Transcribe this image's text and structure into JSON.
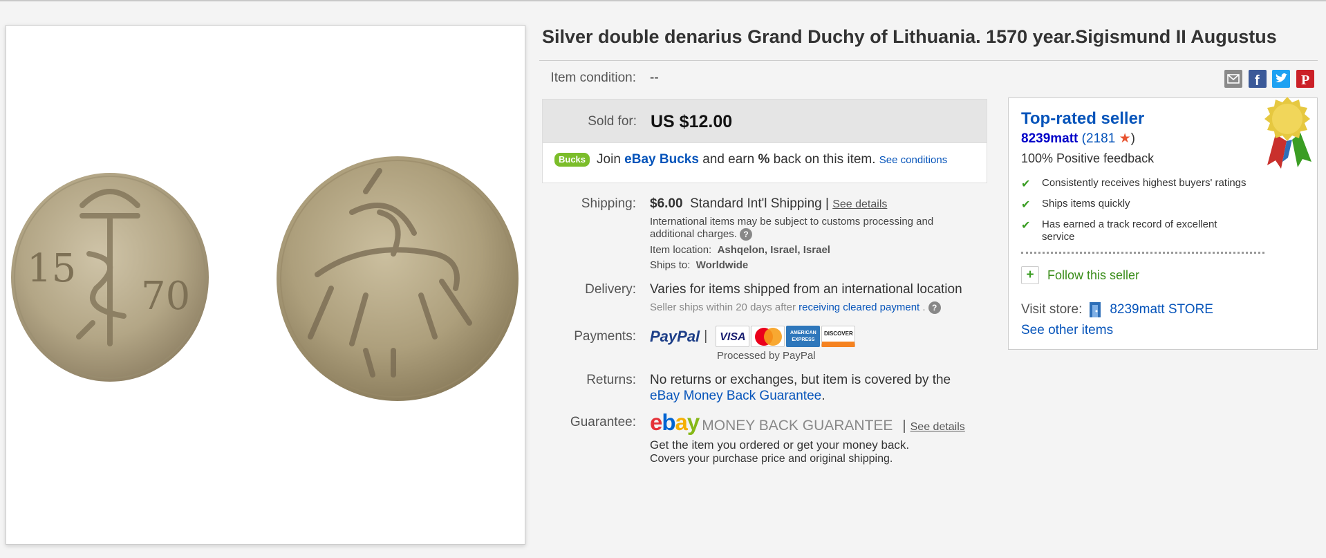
{
  "title": "Silver double denarius Grand Duchy of Lithuania. 1570 year.Sigismund II Augustus",
  "condition": {
    "label": "Item condition:",
    "value": "--"
  },
  "sold": {
    "label": "Sold for:",
    "price": "US $12.00"
  },
  "bucks": {
    "badge": "Bucks",
    "pre": "Join",
    "link": "eBay Bucks",
    "post": "and earn",
    "pct": "%",
    "post2": "back on this item.",
    "conditions": "See conditions"
  },
  "shipping": {
    "label": "Shipping:",
    "cost": "$6.00",
    "method": "Standard Int'l Shipping",
    "sep": "|",
    "details": "See details",
    "note": "International items may be subject to customs processing and additional charges.",
    "location_label": "Item location:",
    "location": "Ashqelon, Israel, Israel",
    "ships_label": "Ships to:",
    "ships_to": "Worldwide"
  },
  "delivery": {
    "label": "Delivery:",
    "value": "Varies for items shipped from an international location",
    "note_pre": "Seller ships within 20 days after",
    "note_link": "receiving cleared payment",
    "note_post": "."
  },
  "payments": {
    "label": "Payments:",
    "paypal": "PayPal",
    "sep": "|",
    "processed": "Processed by PayPal",
    "cards": [
      "VISA",
      "MasterCard",
      "AMERICAN EXPRESS",
      "DISCOVER"
    ]
  },
  "returns": {
    "label": "Returns:",
    "text": "No returns or exchanges, but item is covered by the",
    "link": "eBay Money Back Guarantee",
    "post": "."
  },
  "guarantee": {
    "label": "Guarantee:",
    "logo": "ebay",
    "mbg": "MONEY BACK GUARANTEE",
    "sep": "|",
    "details": "See details",
    "line1": "Get the item you ordered or get your money back.",
    "line2": "Covers your purchase price and original shipping."
  },
  "seller": {
    "title": "Top-rated seller",
    "username": "8239matt",
    "score_open": "(",
    "score": "2181",
    "score_close": ")",
    "feedback": "100% Positive feedback",
    "checks": [
      "Consistently receives highest buyers' ratings",
      "Ships items quickly",
      "Has earned a track record of excellent service"
    ],
    "follow": "Follow this seller",
    "visit_label": "Visit store:",
    "store": "8239matt STORE",
    "other": "See other items"
  },
  "coin_left": {
    "left_digits": "15",
    "right_digits": "70"
  },
  "colors": {
    "link": "#0654ba",
    "green": "#3a9d23",
    "title": "#333333"
  }
}
